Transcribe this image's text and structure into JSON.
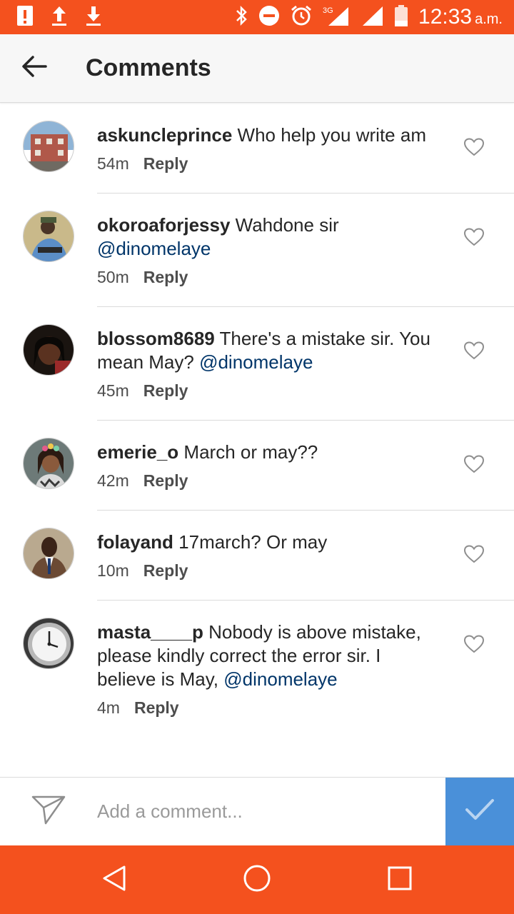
{
  "status_bar": {
    "time": "12:33",
    "ampm": "a.m.",
    "network": "3G",
    "icons": [
      "alert-icon",
      "upload-icon",
      "download-icon",
      "bluetooth-icon",
      "do-not-disturb-icon",
      "alarm-icon",
      "signal-icon",
      "battery-icon"
    ],
    "background": "#f4511e"
  },
  "header": {
    "title": "Comments",
    "back_icon": "arrow-left-icon"
  },
  "comments": [
    {
      "username": "askuncleprince",
      "text": " Who help you write am",
      "mention": "",
      "time": "54m",
      "reply_label": "Reply"
    },
    {
      "username": "okoroaforjessy",
      "text": " Wahdone sir ",
      "mention": "@dinomelaye",
      "time": "50m",
      "reply_label": "Reply"
    },
    {
      "username": "blossom8689",
      "text": " There's a mistake sir. You mean May? ",
      "mention": "@dinomelaye",
      "time": "45m",
      "reply_label": "Reply"
    },
    {
      "username": "emerie_o",
      "text": " March or may??",
      "mention": "",
      "time": "42m",
      "reply_label": "Reply"
    },
    {
      "username": "folayand",
      "text": " 17march? Or may",
      "mention": "",
      "time": "10m",
      "reply_label": "Reply"
    },
    {
      "username": "masta____p",
      "text": " Nobody is above mistake, please kindly correct the error sir. I believe is May, ",
      "mention": "@dinomelaye",
      "time": "4m",
      "reply_label": "Reply"
    }
  ],
  "composer": {
    "placeholder": "Add a comment...",
    "share_icon": "send-icon",
    "post_icon": "checkmark-icon",
    "post_color": "#4a90d9"
  },
  "nav_bar": {
    "icons": [
      "back-triangle-icon",
      "home-circle-icon",
      "recents-square-icon"
    ],
    "background": "#f4511e"
  }
}
